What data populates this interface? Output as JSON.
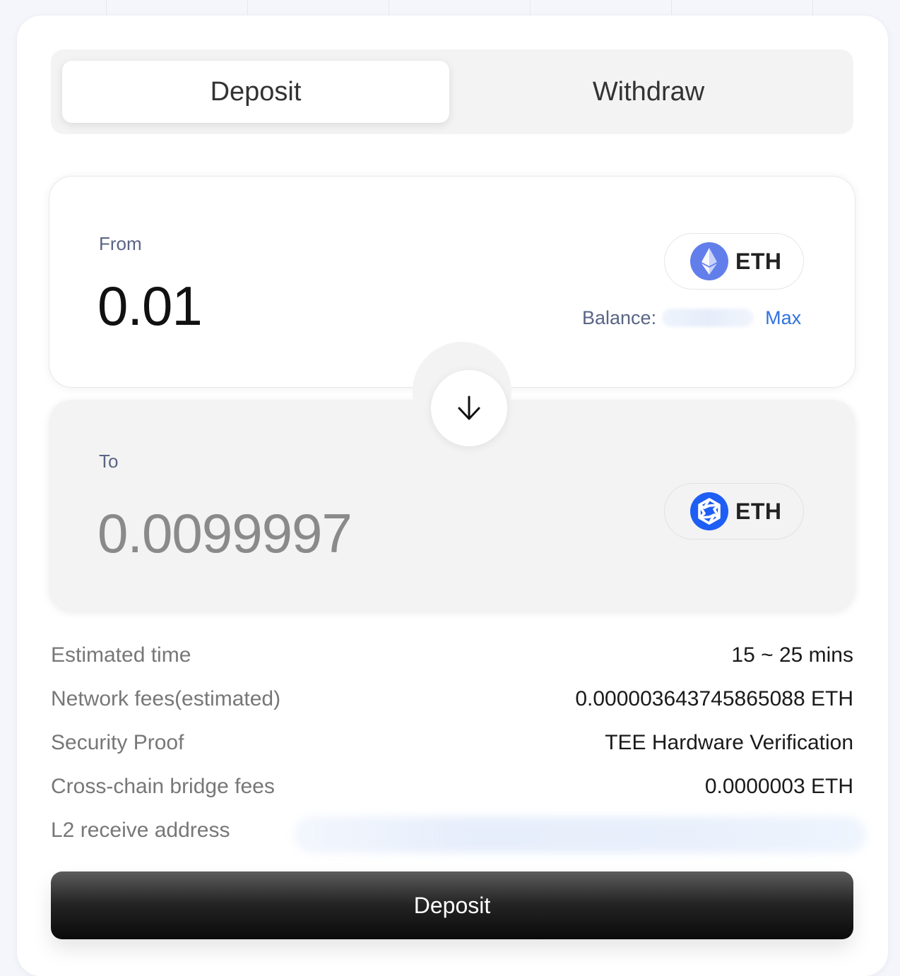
{
  "tabs": {
    "deposit_label": "Deposit",
    "withdraw_label": "Withdraw",
    "active": "deposit"
  },
  "from": {
    "label": "From",
    "amount": "0.01",
    "token": "ETH",
    "token_icon": "ethereum-icon",
    "balance_label": "Balance:",
    "max_label": "Max"
  },
  "to": {
    "label": "To",
    "amount": "0.0099997",
    "token": "ETH",
    "token_icon": "l2-network-icon"
  },
  "details": [
    {
      "label": "Estimated time",
      "value": "15 ~ 25 mins"
    },
    {
      "label": "Network fees(estimated)",
      "value": "0.000003643745865088 ETH"
    },
    {
      "label": "Security Proof",
      "value": "TEE Hardware Verification"
    },
    {
      "label": "Cross-chain bridge fees",
      "value": "0.0000003 ETH"
    },
    {
      "label": "L2 receive address",
      "value": ""
    }
  ],
  "submit": {
    "label": "Deposit"
  },
  "colors": {
    "accent": "#2f72e0",
    "eth_icon": "#627eea",
    "l2_icon": "#1f5ef5",
    "button_dark": "#0a0a0a"
  }
}
